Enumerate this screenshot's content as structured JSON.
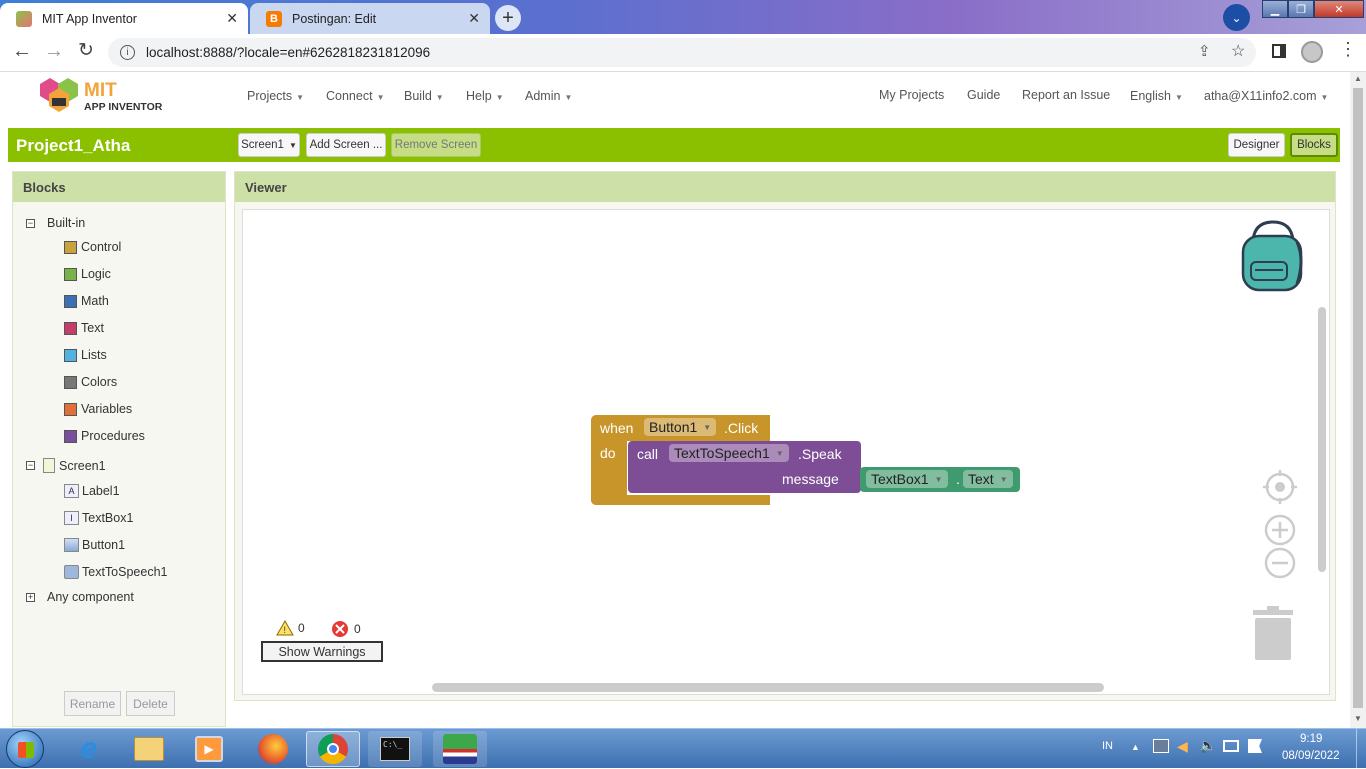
{
  "browser": {
    "tabs": [
      {
        "title": "MIT App Inventor",
        "active": true
      },
      {
        "title": "Postingan: Edit",
        "active": false
      }
    ],
    "url": "localhost:8888/?locale=en#6262818231812096"
  },
  "header": {
    "logo_line1": "MIT",
    "logo_line2": "APP INVENTOR",
    "menus": [
      "Projects",
      "Connect",
      "Build",
      "Help",
      "Admin"
    ],
    "links": [
      "My Projects",
      "Guide",
      "Report an Issue"
    ],
    "language": "English",
    "user": "atha@X11info2.com"
  },
  "project": {
    "name": "Project1_Atha",
    "screen_select": "Screen1",
    "add_screen": "Add Screen ...",
    "remove_screen": "Remove Screen",
    "designer": "Designer",
    "blocks": "Blocks"
  },
  "blocks_panel": {
    "title": "Blocks",
    "builtin_label": "Built-in",
    "builtin": [
      {
        "label": "Control",
        "color": "#c8a23b"
      },
      {
        "label": "Logic",
        "color": "#7ab24a"
      },
      {
        "label": "Math",
        "color": "#3b6fb6"
      },
      {
        "label": "Text",
        "color": "#c43d6b"
      },
      {
        "label": "Lists",
        "color": "#53b3e0"
      },
      {
        "label": "Colors",
        "color": "#777777"
      },
      {
        "label": "Variables",
        "color": "#e0703a"
      },
      {
        "label": "Procedures",
        "color": "#7a4f9c"
      }
    ],
    "screen_label": "Screen1",
    "components": [
      "Label1",
      "TextBox1",
      "Button1",
      "TextToSpeech1"
    ],
    "any_component": "Any component",
    "rename": "Rename",
    "delete": "Delete"
  },
  "viewer": {
    "title": "Viewer",
    "event_block": {
      "when": "when",
      "component": "Button1",
      "event": ".Click",
      "do": "do"
    },
    "call_block": {
      "call": "call",
      "component": "TextToSpeech1",
      "method": ".Speak",
      "arg": "message"
    },
    "getter_block": {
      "component": "TextBox1",
      "dot": ".",
      "property": "Text"
    },
    "warnings_count": "0",
    "errors_count": "0",
    "show_warnings": "Show Warnings"
  },
  "taskbar": {
    "lang": "IN",
    "time": "9:19",
    "date": "08/09/2022"
  }
}
